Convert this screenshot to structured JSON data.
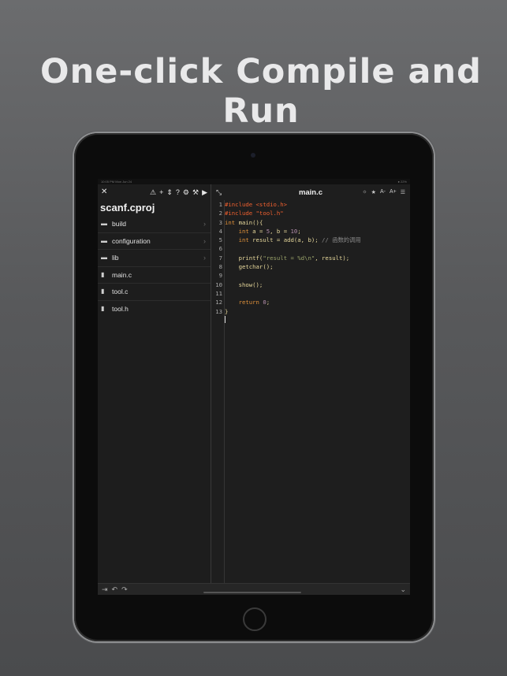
{
  "headline": "One-click Compile and Run",
  "status": {
    "time": "10:05 PM  Mon Jun 24",
    "battery": "● 22%"
  },
  "sidebar": {
    "toolbar_icons": {
      "close": "✕",
      "warning": "⚠",
      "add": "+",
      "sort": "⇕",
      "help": "?",
      "settings": "⚙",
      "build": "⚒",
      "run": "▶"
    },
    "project_title": "scanf.cproj",
    "items": [
      {
        "name": "build",
        "type": "folder"
      },
      {
        "name": "configuration",
        "type": "folder"
      },
      {
        "name": "lib",
        "type": "folder"
      },
      {
        "name": "main.c",
        "type": "file"
      },
      {
        "name": "tool.c",
        "type": "file"
      },
      {
        "name": "tool.h",
        "type": "file"
      }
    ]
  },
  "editor": {
    "expand_icon": "⤡",
    "filename": "main.c",
    "tools": {
      "theme": "☼",
      "star": "★",
      "font_smaller": "A-",
      "font_larger": "A+",
      "menu": "☰"
    },
    "line_numbers": [
      "1",
      "2",
      "3",
      "4",
      "5",
      "6",
      "7",
      "8",
      "9",
      "10",
      "11",
      "12",
      "13"
    ],
    "code": {
      "l1": "#include <stdio.h>",
      "l2": "#include \"tool.h\"",
      "l3_kw": "int",
      "l3_rest": " main(){",
      "l4_kw": "int",
      "l4_a": " a = ",
      "l4_n1": "5",
      "l4_b": ", b = ",
      "l4_n2": "10",
      "l4_end": ";",
      "l5_kw": "int",
      "l5_a": " result = add(a, b); ",
      "l5_cmt": "// 函数的调用",
      "l7_fn": "printf(",
      "l7_str": "\"result = %d\\n\"",
      "l7_end": ", result);",
      "l8": "getchar();",
      "l10": "show();",
      "l12_kw": "return",
      "l12_sp": " ",
      "l12_num": "0",
      "l12_end": ";",
      "l13": "}"
    }
  },
  "bottombar": {
    "tab": "⇥",
    "undo": "↶",
    "redo": "↷",
    "hide_keyboard": "⌄"
  }
}
